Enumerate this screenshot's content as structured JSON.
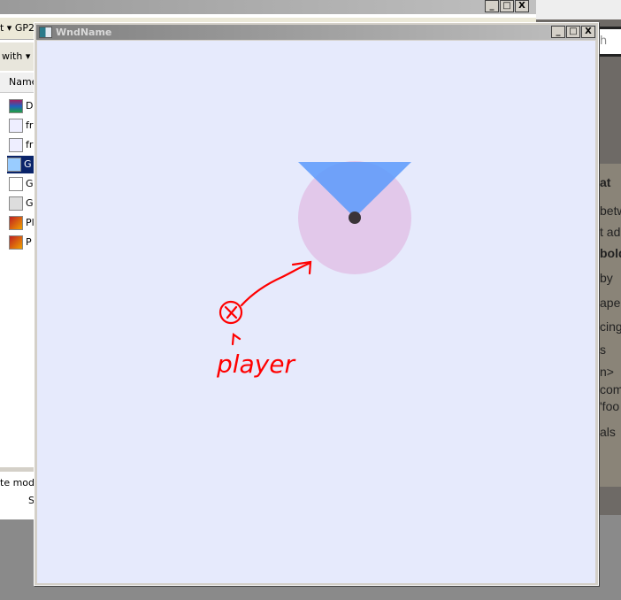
{
  "background_explorer": {
    "address_fragment": "t ▾ GP2",
    "toolbar_fragment": "with ▾",
    "column_header": "Name",
    "files": [
      {
        "label": "D",
        "icon": "archive-icon"
      },
      {
        "label": "fr",
        "icon": "image-file-icon"
      },
      {
        "label": "fr",
        "icon": "image-file-icon"
      },
      {
        "label": "G",
        "icon": "application-icon",
        "selected": true
      },
      {
        "label": "G",
        "icon": "document-icon"
      },
      {
        "label": "G",
        "icon": "audio-file-icon"
      },
      {
        "label": "Pl",
        "icon": "media-file-icon"
      },
      {
        "label": "P",
        "icon": "media-file-icon"
      }
    ],
    "status_line1": "te modif",
    "status_line2": "S",
    "controls": [
      "_",
      "□",
      "X"
    ]
  },
  "background_right": {
    "search_fragment": "h",
    "lines": [
      "at",
      "betw",
      "t ad",
      "bold",
      "by",
      "ape",
      "cing",
      "s",
      "n>",
      "com",
      "'foo",
      "als"
    ]
  },
  "window": {
    "title": "WndName",
    "controls": [
      "_",
      "□",
      "X"
    ],
    "client_color": "#e6eafc",
    "scene": {
      "circle_color": "#e2c8ea",
      "cone_color": "#5a9afc",
      "dot_color": "#3a3438",
      "annotation_color": "#ff0000",
      "annotation_label": "player"
    }
  }
}
